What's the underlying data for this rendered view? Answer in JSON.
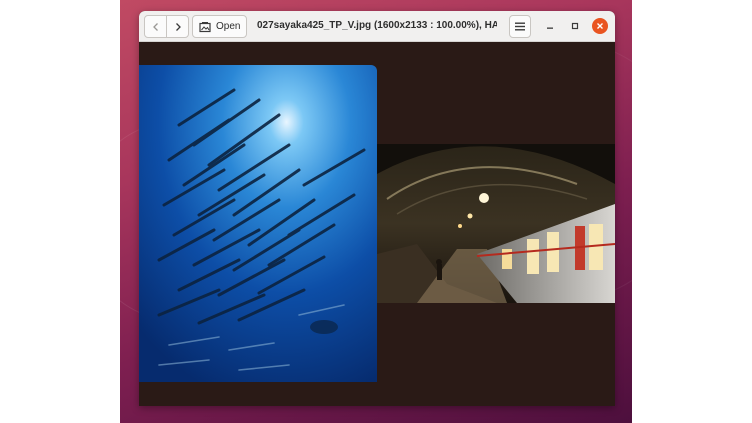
{
  "window": {
    "title": "027sayaka425_TP_V.jpg (1600x2133 : 100.00%), HAW…",
    "open_label": "Open"
  },
  "icons": {
    "back": "chevron-left-icon",
    "forward": "chevron-right-icon",
    "open": "image-open-icon",
    "menu": "hamburger-menu-icon",
    "minimize": "minimize-icon",
    "maximize": "maximize-icon",
    "close": "close-icon"
  },
  "colors": {
    "accent_close": "#e95420",
    "viewer_background": "#2a1a16",
    "headerbar": "#f1f0ef"
  },
  "images": [
    {
      "name": "barracuda school underwater photo"
    },
    {
      "name": "underground train platform photo"
    }
  ]
}
